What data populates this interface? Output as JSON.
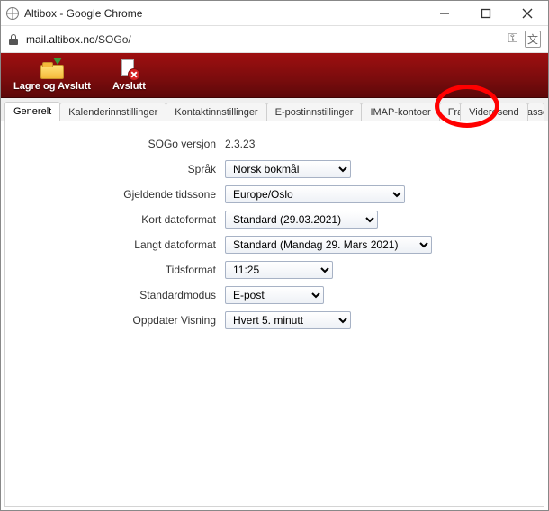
{
  "window": {
    "title": "Altibox - Google Chrome"
  },
  "address": {
    "host": "mail.altibox.no",
    "path": "/SOGo/"
  },
  "toolbar": {
    "save_and_quit": "Lagre og Avslutt",
    "quit": "Avslutt"
  },
  "tabs": [
    {
      "label": "Generelt",
      "active": true
    },
    {
      "label": "Kalenderinnstillinger"
    },
    {
      "label": "Kontaktinnstillinger"
    },
    {
      "label": "E-postinnstillinger"
    },
    {
      "label": "IMAP-kontoer"
    },
    {
      "label": "Fravær"
    },
    {
      "label": "Videresend"
    },
    {
      "label": "Passord"
    }
  ],
  "form": {
    "version_label": "SOGo versjon",
    "version_value": "2.3.23",
    "language_label": "Språk",
    "language_value": "Norsk bokmål",
    "timezone_label": "Gjeldende tidssone",
    "timezone_value": "Europe/Oslo",
    "short_date_label": "Kort datoformat",
    "short_date_value": "Standard (29.03.2021)",
    "long_date_label": "Langt datoformat",
    "long_date_value": "Standard (Mandag 29. Mars 2021)",
    "time_format_label": "Tidsformat",
    "time_format_value": "11:25",
    "default_mode_label": "Standardmodus",
    "default_mode_value": "E-post",
    "refresh_label": "Oppdater Visning",
    "refresh_value": "Hvert 5. minutt"
  }
}
